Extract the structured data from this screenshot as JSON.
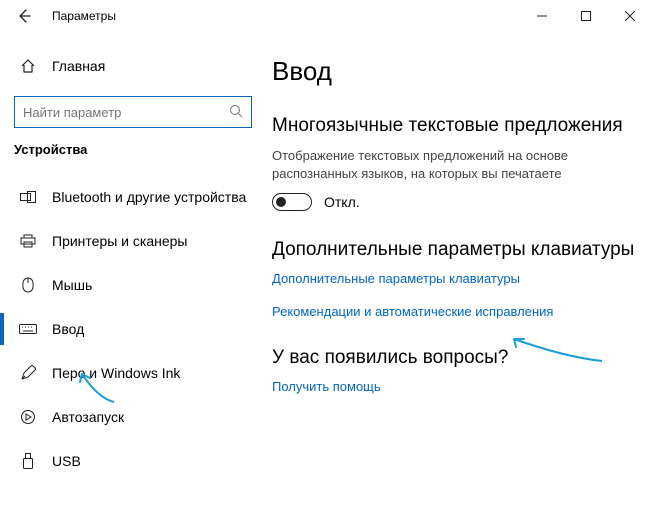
{
  "window": {
    "title": "Параметры"
  },
  "sidebar": {
    "home_label": "Главная",
    "search_placeholder": "Найти параметр",
    "group_title": "Устройства",
    "items": [
      {
        "label": "Bluetooth и другие устройства"
      },
      {
        "label": "Принтеры и сканеры"
      },
      {
        "label": "Мышь"
      },
      {
        "label": "Ввод"
      },
      {
        "label": "Перо и Windows Ink"
      },
      {
        "label": "Автозапуск"
      },
      {
        "label": "USB"
      }
    ]
  },
  "content": {
    "page_title": "Ввод",
    "section1_title": "Многоязычные текстовые предложения",
    "section1_desc": "Отображение текстовых предложений на основе распознанных языков, на которых вы печатаете",
    "toggle_label": "Откл.",
    "section2_title": "Дополнительные параметры клавиатуры",
    "link1": "Дополнительные параметры клавиатуры",
    "link2": "Рекомендации и автоматические исправления",
    "section3_title": "У вас появились вопросы?",
    "link3": "Получить помощь"
  }
}
